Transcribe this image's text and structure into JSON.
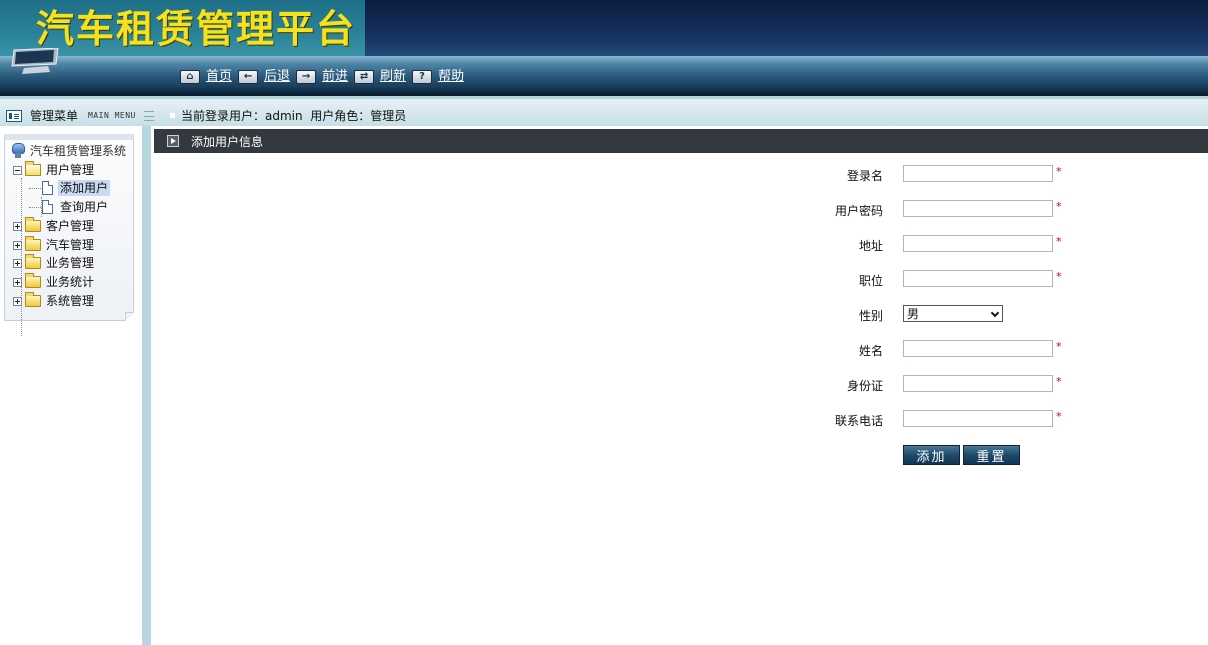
{
  "header": {
    "app_title": "汽车租赁管理平台",
    "toolbar": [
      {
        "icon": "home-icon",
        "glyph": "⌂",
        "label": "首页"
      },
      {
        "icon": "back-arrow-icon",
        "glyph": "←",
        "label": "后退"
      },
      {
        "icon": "forward-arrow-icon",
        "glyph": "→",
        "label": "前进"
      },
      {
        "icon": "refresh-icon",
        "glyph": "⇄",
        "label": "刷新"
      },
      {
        "icon": "help-icon",
        "glyph": "?",
        "label": "帮助"
      }
    ]
  },
  "statusbar": {
    "menu_title": "管理菜单",
    "menu_title_en": "MAIN MENU",
    "login_info": "当前登录用户：admin  用户角色：管理员"
  },
  "sidebar": {
    "root": "汽车租赁管理系统",
    "groups": [
      {
        "label": "用户管理",
        "expanded": true,
        "children": [
          "添加用户",
          "查询用户"
        ]
      },
      {
        "label": "客户管理",
        "expanded": false
      },
      {
        "label": "汽车管理",
        "expanded": false
      },
      {
        "label": "业务管理",
        "expanded": false
      },
      {
        "label": "业务统计",
        "expanded": false
      },
      {
        "label": "系统管理",
        "expanded": false
      }
    ],
    "selected": "添加用户"
  },
  "main": {
    "panel_title": "添加用户信息",
    "form": {
      "fields": [
        {
          "label": "登录名",
          "value": "",
          "required": true
        },
        {
          "label": "用户密码",
          "value": "",
          "required": true
        },
        {
          "label": "地址",
          "value": "",
          "required": true
        },
        {
          "label": "职位",
          "value": "",
          "required": true
        },
        {
          "label": "性别",
          "type": "select",
          "value": "男"
        },
        {
          "label": "姓名",
          "value": "",
          "required": true
        },
        {
          "label": "身份证",
          "value": "",
          "required": true
        },
        {
          "label": "联系电话",
          "value": "",
          "required": true
        }
      ],
      "required_mark": "*",
      "submit_label": "添加",
      "reset_label": "重置"
    }
  },
  "colors": {
    "title_yellow": "#f5e21c",
    "panel_header": "#34393f",
    "required_red": "#d80000",
    "button_blue": "#1f4b6b"
  }
}
